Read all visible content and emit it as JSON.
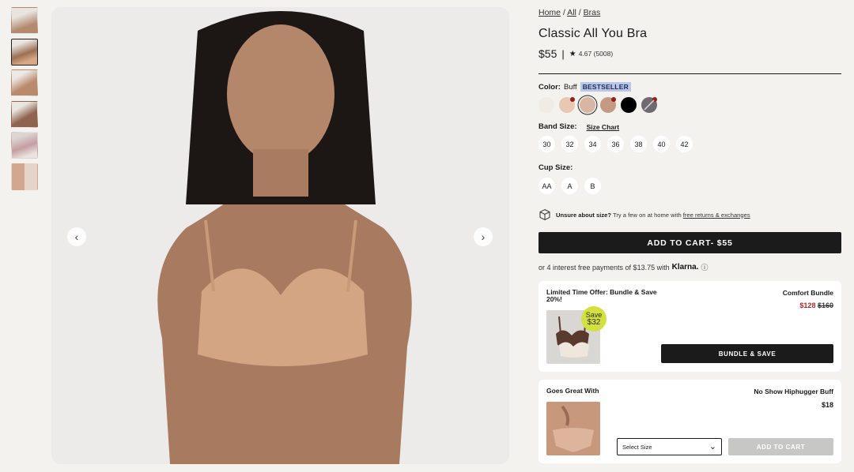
{
  "breadcrumb": {
    "home": "Home",
    "all": "All",
    "bras": "Bras",
    "sep": "/"
  },
  "product": {
    "title": "Classic All You Bra",
    "price": "$55",
    "price_sep": "|",
    "rating_star": "★",
    "rating": "4.67 (5008)"
  },
  "color": {
    "label": "Color:",
    "value": "Buff",
    "badge": "BESTSELLER",
    "swatches": [
      "#f1ebe6",
      "#e8c7b3",
      "#d7b6a3",
      "#c59a84",
      "#000000",
      "#6e6a70"
    ]
  },
  "band": {
    "label": "Band Size:",
    "size_chart": "Size Chart",
    "sizes": [
      "30",
      "32",
      "34",
      "36",
      "38",
      "40",
      "42"
    ]
  },
  "cup": {
    "label": "Cup Size:",
    "sizes": [
      "AA",
      "A",
      "B"
    ]
  },
  "unsure": {
    "bold": "Unsure about size?",
    "text": " Try a few on at home with ",
    "link": "free returns & exchanges"
  },
  "cart": {
    "label": "ADD TO CART- $55"
  },
  "klarna": {
    "text": "or 4 interest free payments of $13.75 with",
    "brand": "Klarna.",
    "info": "ⓘ"
  },
  "bundle": {
    "title": "Limited Time Offer: Bundle & Save 20%!",
    "name": "Comfort Bundle",
    "sale_price": "$128",
    "orig_price": "$160",
    "save_line1": "Save",
    "save_line2": "$32",
    "button": "BUNDLE & SAVE"
  },
  "pair": {
    "title": "Goes Great With",
    "name": "No Show Hiphugger Buff",
    "price": "$18",
    "select": "Select Size",
    "chevron": "⌄",
    "button": "ADD TO CART"
  },
  "arrows": {
    "prev": "‹",
    "next": "›"
  }
}
